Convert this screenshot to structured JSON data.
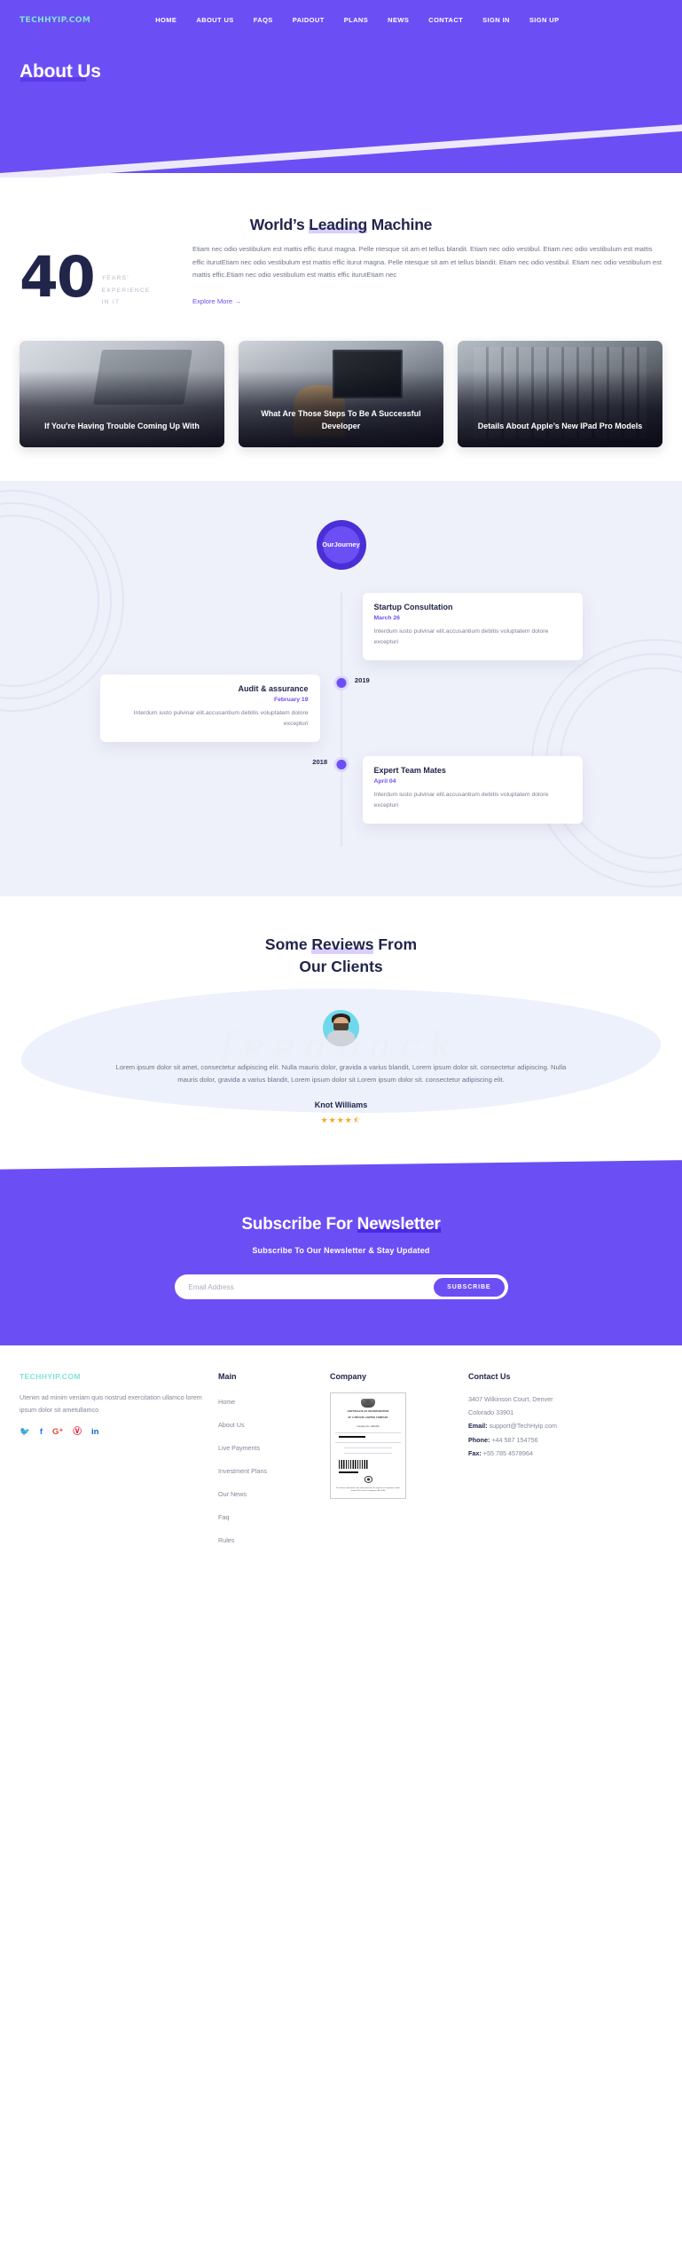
{
  "brand": {
    "logo": "TechHyip.com",
    "logo_color": "#7fe3d6"
  },
  "theme": {
    "primary": "#6c4ef5",
    "primary_dark": "#4b2fd6",
    "navy": "#21254a",
    "star": "#f5a623"
  },
  "nav": {
    "items": [
      {
        "label": "HOME"
      },
      {
        "label": "ABOUT US"
      },
      {
        "label": "FAQS"
      },
      {
        "label": "PAIDOUT"
      },
      {
        "label": "PLANS"
      },
      {
        "label": "NEWS"
      },
      {
        "label": "CONTACT"
      },
      {
        "label": "SIGN IN"
      },
      {
        "label": "SIGN UP"
      }
    ]
  },
  "hero": {
    "title": "About Us"
  },
  "leading": {
    "title_before": "World’s ",
    "title_highlight": "Leading",
    "title_after": " Machine",
    "stat_number": "40",
    "stat_line1": "YEARS’",
    "stat_line2": "EXPERIENCE",
    "stat_line3": "IN IT",
    "paragraph": "Etiam nec odio vestibulum est mattis effic iturut magna. Pelle ntesque sit am et tellus blandit. Etiam nec odio vestibul. Etiam nec odio vestibulum est mattis effic iturutEtiam nec odio vestibulum est mattis effic iturut magna. Pelle ntesque sit am et tellus blandit. Etiam nec odio vestibul. Etiam nec odio vestibulum est mattis effic.Etiam nec odio vestibulum est mattis effic iturutEtiam nec",
    "explore_label": "Explore More →"
  },
  "cards": [
    {
      "title": "If You're Having Trouble Coming Up With",
      "image": "laptop-desk-photo"
    },
    {
      "title": "What Are Those Steps To Be A Successful Developer",
      "image": "developer-at-desk-photo"
    },
    {
      "title": "Details About Apple’s New IPad Pro Models",
      "image": "high-five-office-photo"
    }
  ],
  "journey": {
    "badge_line1": "Our",
    "badge_line2": "Journey",
    "entries": [
      {
        "side": "right",
        "title": "Startup Consultation",
        "date": "March 26",
        "text": "Interdum iusto pulvinar elit.accusantium debitis voluptatem dolore excepturi",
        "year": ""
      },
      {
        "side": "left",
        "title": "Audit & assurance",
        "date": "February 19",
        "text": "Interdum iusto pulvinar elit.accusantium debitis voluptatem dolore excepturi",
        "year": "2019"
      },
      {
        "side": "right",
        "title": "Expert Team Mates",
        "date": "April 04",
        "text": "Interdum iusto pulvinar elit.accusantium debitis voluptatem dolore excepturi",
        "year": "2018"
      }
    ],
    "year_1": "2019",
    "year_2": "2018"
  },
  "reviews": {
    "title_line1_before": "Some ",
    "title_line1_highlight": "Reviews",
    "title_line1_after": " From",
    "title_line2": "Our Clients",
    "watermark": "feedback",
    "quote": "Lorem ipsum dolor sit amet, consectetur adipiscing elit. Nulla mauris dolor, gravida a varius blandit, Lorem ipsum dolor sit. consectetur adipiscing. Nulla mauris dolor, gravida a varius blandit, Lorem ipsum dolor sit Lorem ipsum dolor sit. consectetur adipiscing elit.",
    "name": "Knot Williams",
    "rating": 4.5,
    "stars": "★★★★⯪"
  },
  "newsletter": {
    "title_before": "Subscribe For ",
    "title_highlight": "Newsletter",
    "subtitle": "Subscribe To Our Newsletter & Stay Updated",
    "placeholder": "Email Address",
    "button": "SUBSCRIBE"
  },
  "footer": {
    "logo": "TechHyip.com",
    "description": "Utenim ad minim veniam quis nostrud exercitation ullamco lorem ipsum dolor sit ametullamco",
    "socials": [
      {
        "name": "twitter-icon",
        "glyph": "🐦",
        "char": "t"
      },
      {
        "name": "facebook-icon",
        "char": "f"
      },
      {
        "name": "google-plus-icon",
        "char": "G+"
      },
      {
        "name": "pinterest-icon",
        "char": "ⓟ"
      },
      {
        "name": "linkedin-icon",
        "char": "in"
      }
    ],
    "main": {
      "heading": "Main",
      "links": [
        {
          "label": "Home"
        },
        {
          "label": "About Us"
        },
        {
          "label": "Live Payments"
        },
        {
          "label": "Investment Plans"
        },
        {
          "label": "Our News"
        },
        {
          "label": "Faq"
        },
        {
          "label": "Rules"
        }
      ]
    },
    "company": {
      "heading": "Company",
      "certificate": {
        "title_line1": "CERTIFICATE OF INCORPORATION",
        "title_line2": "OF A PRIVATE LIMITED COMPANY",
        "company_no": "Company No. 11111000",
        "footer_note": "The above information was extracted from the register of companies under section 1113 of the Companies Act 2006"
      }
    },
    "contact": {
      "heading": "Contact Us",
      "address_line1": "3407 Wilkinson Court, Denver",
      "address_line2": "Colorado 33901",
      "email_label": "Email:",
      "email": "support@TechHyip.com",
      "phone_label": "Phone:",
      "phone": "+44 587 154756",
      "fax_label": "Fax:",
      "fax": "+55 785 4578964"
    }
  }
}
